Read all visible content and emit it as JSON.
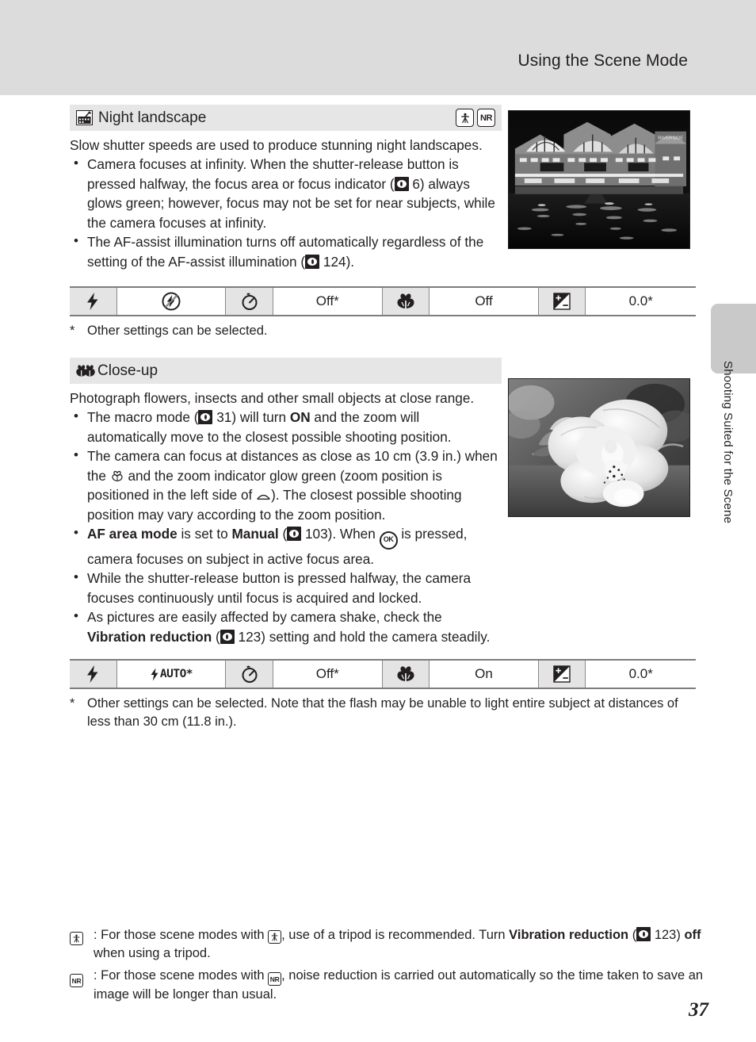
{
  "header": {
    "title": "Using the Scene Mode"
  },
  "side_tab": {
    "label": "Shooting Suited for the Scene"
  },
  "page_number": "37",
  "sections": [
    {
      "id": "night-landscape",
      "icon": "night-landscape-icon",
      "title": "Night landscape",
      "flags": [
        "tripod-icon",
        "NR"
      ],
      "intro": "Slow shutter speeds are used to produce stunning night landscapes.",
      "bullets": [
        {
          "parts": [
            {
              "t": "text",
              "v": "Camera focuses at infinity. When the shutter-release button is pressed halfway, the focus area or focus indicator ("
            },
            {
              "t": "pref",
              "v": "page-ref-icon"
            },
            {
              "t": "text",
              "v": " 6) always glows green; however, focus may not be set for near subjects, while the camera focuses at infinity."
            }
          ]
        },
        {
          "parts": [
            {
              "t": "text",
              "v": "The AF-assist illumination turns off automatically regardless of the setting of the AF-assist illumination ("
            },
            {
              "t": "pref",
              "v": "page-ref-icon"
            },
            {
              "t": "text",
              "v": " 124)."
            }
          ]
        }
      ],
      "photo_alt": "night-landscape-photo",
      "table": [
        {
          "icon": "flash-mode-icon",
          "value_icon": "flash-off-icon",
          "value": ""
        },
        {
          "icon": "self-timer-icon",
          "value": "Off*"
        },
        {
          "icon": "macro-mode-icon",
          "value": "Off"
        },
        {
          "icon": "exposure-compensation-icon",
          "value": "0.0*"
        }
      ],
      "footnote": {
        "mark": "*",
        "text": "Other settings can be selected."
      }
    },
    {
      "id": "close-up",
      "icon": "close-up-icon",
      "title": "Close-up",
      "flags": [],
      "intro": "Photograph flowers, insects and other small objects at close range.",
      "bullets": [
        {
          "parts": [
            {
              "t": "text",
              "v": "The macro mode ("
            },
            {
              "t": "pref",
              "v": "page-ref-icon"
            },
            {
              "t": "text",
              "v": " 31) will turn "
            },
            {
              "t": "bold",
              "v": "ON"
            },
            {
              "t": "text",
              "v": " and the zoom will automatically move to the closest possible shooting position."
            }
          ]
        },
        {
          "parts": [
            {
              "t": "text",
              "v": "The camera can focus at distances as close as 10 cm (3.9 in.) when the "
            },
            {
              "t": "macro",
              "v": "macro-flower-icon"
            },
            {
              "t": "text",
              "v": " and the zoom indicator glow green (zoom position is positioned in the left side of "
            },
            {
              "t": "zoomtri",
              "v": "zoom-indicator-icon"
            },
            {
              "t": "text",
              "v": "). The closest possible shooting position may vary according to the zoom position."
            }
          ]
        },
        {
          "parts": [
            {
              "t": "bold",
              "v": "AF area mode"
            },
            {
              "t": "text",
              "v": " is set to "
            },
            {
              "t": "bold",
              "v": "Manual"
            },
            {
              "t": "text",
              "v": " ("
            },
            {
              "t": "pref",
              "v": "page-ref-icon"
            },
            {
              "t": "text",
              "v": " 103). When "
            },
            {
              "t": "ok",
              "v": "OK"
            },
            {
              "t": "text",
              "v": " is pressed, camera focuses on subject in active focus area."
            }
          ]
        },
        {
          "parts": [
            {
              "t": "text",
              "v": "While the shutter-release button is pressed halfway, the camera focuses continuously until focus is acquired and locked."
            }
          ]
        },
        {
          "parts": [
            {
              "t": "text",
              "v": "As pictures are easily affected by camera shake, check the "
            },
            {
              "t": "bold",
              "v": "Vibration reduction"
            },
            {
              "t": "text",
              "v": " ("
            },
            {
              "t": "pref",
              "v": "page-ref-icon"
            },
            {
              "t": "text",
              "v": " 123) setting and hold the camera steadily."
            }
          ]
        }
      ],
      "photo_alt": "close-up-flower-photo",
      "table": [
        {
          "icon": "flash-mode-icon",
          "value": "AUTO*",
          "value_prefix_icon": "flash-bolt-icon"
        },
        {
          "icon": "self-timer-icon",
          "value": "Off*"
        },
        {
          "icon": "macro-mode-icon",
          "value": "On"
        },
        {
          "icon": "exposure-compensation-icon",
          "value": "0.0*"
        }
      ],
      "footnote": {
        "mark": "*",
        "text": "Other settings can be selected. Note that the flash may be unable to light entire subject at distances of less than 30 cm (11.8 in.)."
      }
    }
  ],
  "notes": [
    {
      "mark": "tripod-icon",
      "parts": [
        {
          "t": "text",
          "v": ": For those scene modes with "
        },
        {
          "t": "flag",
          "v": "tripod-icon"
        },
        {
          "t": "text",
          "v": ", use of a tripod is recommended. Turn "
        },
        {
          "t": "bold",
          "v": "Vibration reduction"
        },
        {
          "t": "text",
          "v": " ("
        },
        {
          "t": "pref",
          "v": "page-ref-icon"
        },
        {
          "t": "text",
          "v": " 123) "
        },
        {
          "t": "bold",
          "v": "off"
        },
        {
          "t": "text",
          "v": " when using a tripod."
        }
      ]
    },
    {
      "mark": "NR",
      "parts": [
        {
          "t": "text",
          "v": ": For those scene modes with "
        },
        {
          "t": "flag",
          "v": "NR"
        },
        {
          "t": "text",
          "v": ", noise reduction is carried out automatically so the time taken to save an image will be longer than usual."
        }
      ]
    }
  ],
  "colors": {
    "header_band": "#dcdcdc",
    "section_header": "#e6e6e6",
    "table_icon_cell": "#e4e4e4",
    "tab": "#c9c9c9",
    "text": "#231f20"
  }
}
